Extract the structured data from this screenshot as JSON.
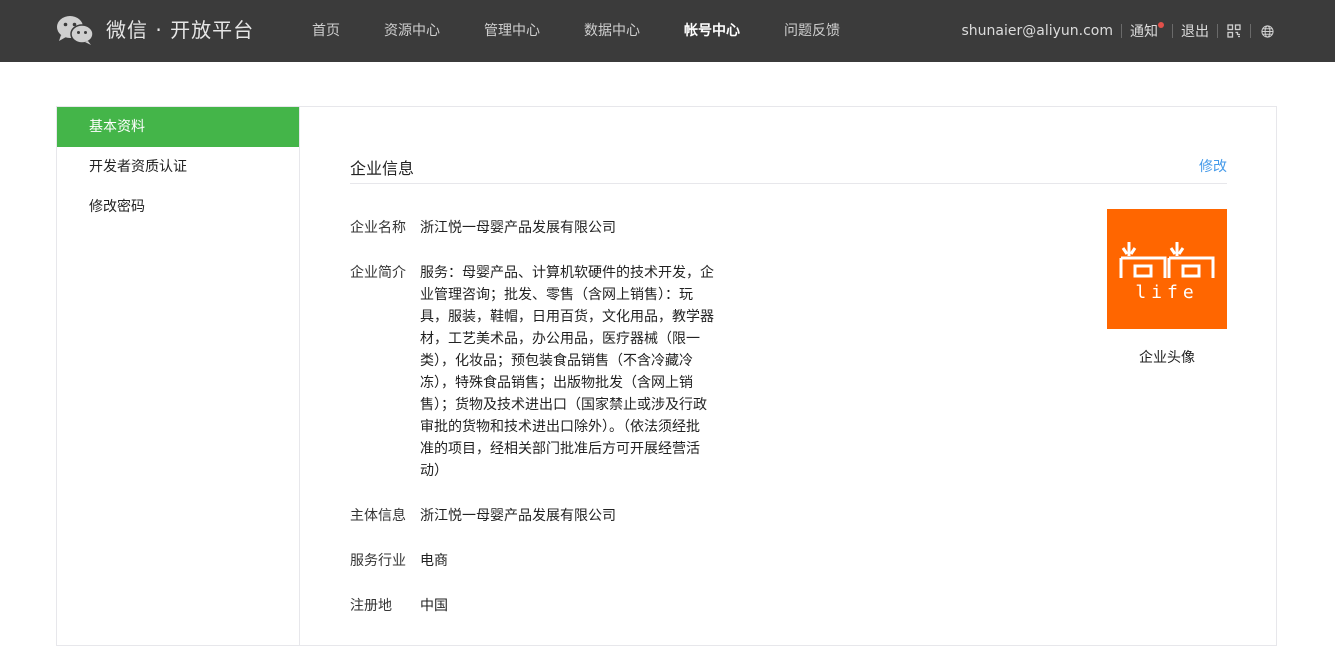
{
  "header": {
    "brand": "微信 · 开放平台",
    "nav": [
      "首页",
      "资源中心",
      "管理中心",
      "数据中心",
      "帐号中心",
      "问题反馈"
    ],
    "active_nav": "帐号中心",
    "user_email": "shunaier@aliyun.com",
    "notify_label": "通知",
    "logout_label": "退出",
    "icons": [
      "wechat-logo",
      "qrcode-icon",
      "globe-icon"
    ]
  },
  "sidebar": {
    "items": [
      "基本资料",
      "开发者资质认证",
      "修改密码"
    ],
    "active": "基本资料"
  },
  "section": {
    "title": "企业信息",
    "edit_label": "修改"
  },
  "info": {
    "name_label": "企业名称",
    "name_value": "浙江悦一母婴产品发展有限公司",
    "intro_label": "企业简介",
    "intro_lines": [
      "服务：母婴产品、计算机软硬件的技术开发，企",
      "业管理咨询；批发、零售（含网上销售）：玩",
      "具，服装，鞋帽，日用百货，文化用品，教学器",
      "材，工艺美术品，办公用品，医疗器械（限一",
      "类），化妆品；预包装食品销售（不含冷藏冷",
      "冻），特殊食品销售；出版物批发（含网上销",
      "售）；货物及技术进出口（国家禁止或涉及行政",
      "审批的货物和技术进出口除外）。（依法须经批",
      "准的项目，经相关部门批准后方可开展经营活",
      "动）"
    ],
    "subject_label": "主体信息",
    "subject_value": "浙江悦一母婴产品发展有限公司",
    "industry_label": "服务行业",
    "industry_value": "电商",
    "region_label": "注册地",
    "region_value": "中国"
  },
  "avatar": {
    "caption": "企业头像",
    "logo_text": "life",
    "color": "#ff6600"
  },
  "colors": {
    "topbar": "#3b3b3b",
    "accent_green": "#44b549",
    "link_blue": "#459ae9"
  }
}
